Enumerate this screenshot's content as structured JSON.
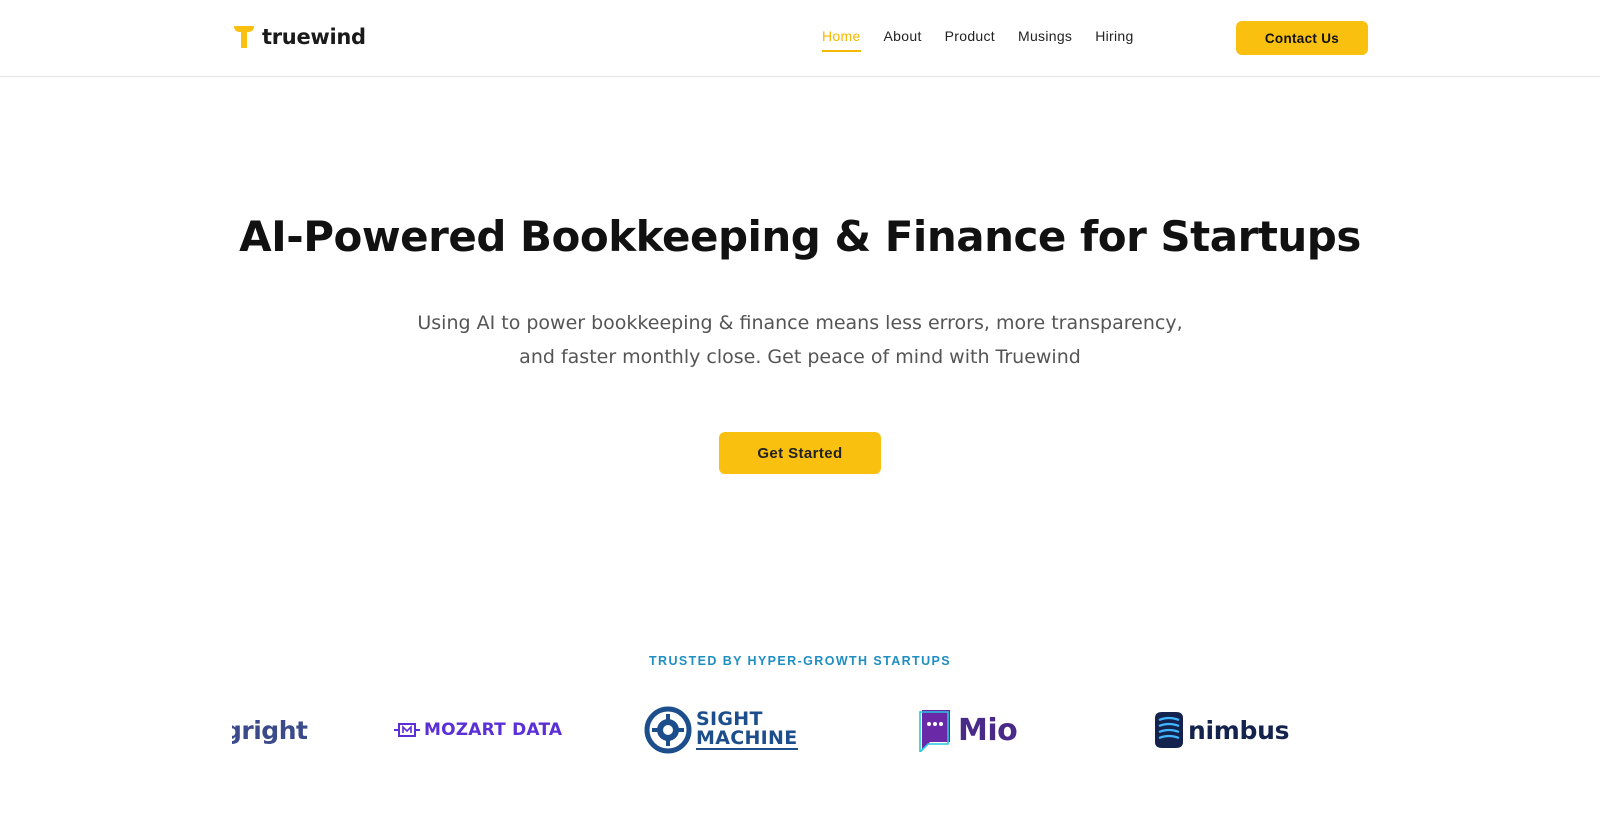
{
  "brand": {
    "name": "truewind",
    "accent": "#f9c010",
    "nav_active": "#f5b800"
  },
  "nav": {
    "items": [
      {
        "label": "Home",
        "active": true
      },
      {
        "label": "About",
        "active": false
      },
      {
        "label": "Product",
        "active": false
      },
      {
        "label": "Musings",
        "active": false
      },
      {
        "label": "Hiring",
        "active": false
      }
    ],
    "contact_label": "Contact Us"
  },
  "hero": {
    "title": "AI-Powered Bookkeeping & Finance for Startups",
    "subtitle_line1": "Using AI to power bookkeeping & finance means less errors, more transparency,",
    "subtitle_line2": "and faster monthly close. Get peace of mind with Truewind",
    "cta_label": "Get Started"
  },
  "trusted": {
    "heading": "TRUSTED BY HYPER-GROWTH STARTUPS",
    "logos": [
      {
        "name": "gright",
        "text": "gright",
        "icon": "partial-logo"
      },
      {
        "name": "mozart-data",
        "text": "MOZART DATA",
        "icon": "mozart-data-logo"
      },
      {
        "name": "sight-machine",
        "text_line1": "SIGHT",
        "text_line2": "MACHINE",
        "icon": "gear-logo"
      },
      {
        "name": "mio",
        "text": "Mio",
        "icon": "chat-bubble-logo"
      },
      {
        "name": "nimbus",
        "text": "nimbus",
        "icon": "stack-logo"
      }
    ]
  }
}
